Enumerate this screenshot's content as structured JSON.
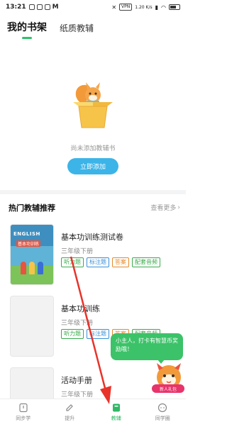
{
  "status_bar": {
    "time": "13:21",
    "left_text": "M",
    "vpn": "VPN",
    "speed": "1.20 K/s",
    "battery": "61"
  },
  "header": {
    "tabs": [
      {
        "label": "我的书架",
        "active": true
      },
      {
        "label": "纸质教辅",
        "active": false
      }
    ]
  },
  "bookshelf": {
    "empty_text": "尚未添加教辅书",
    "add_button": "立即添加"
  },
  "recommend": {
    "title": "热门教辅推荐",
    "see_more": "查看更多",
    "books": [
      {
        "title": "基本功训练测试卷",
        "grade": "三年级下册",
        "cover_title": "ENGLISH",
        "cover_subtitle": "基本功训练",
        "tags": [
          {
            "label": "听力题",
            "color": "green"
          },
          {
            "label": "标注题",
            "color": "blue"
          },
          {
            "label": "答案",
            "color": "orange"
          },
          {
            "label": "配套音频",
            "color": "green"
          }
        ]
      },
      {
        "title": "基本功训练",
        "grade": "三年级下册",
        "tags": [
          {
            "label": "听力题",
            "color": "green"
          },
          {
            "label": "标注题",
            "color": "blue"
          },
          {
            "label": "答案",
            "color": "orange"
          },
          {
            "label": "配套音频",
            "color": "green"
          }
        ]
      },
      {
        "title": "活动手册",
        "grade": "三年级下册",
        "tags": []
      }
    ]
  },
  "bubble": {
    "text": "小主人，打卡有智慧币奖励哦！"
  },
  "gift": {
    "label": "新人礼包"
  },
  "bottom_nav": [
    {
      "label": "同步学",
      "icon": "sync-learn-icon",
      "active": false
    },
    {
      "label": "提升",
      "icon": "pencil-icon",
      "active": false
    },
    {
      "label": "教辅",
      "icon": "book-icon",
      "active": true
    },
    {
      "label": "同学圈",
      "icon": "chat-icon",
      "active": false
    }
  ],
  "colors": {
    "accent_green": "#2fb865",
    "button_blue": "#3cb4e8",
    "annotation_red": "#e8332a"
  }
}
